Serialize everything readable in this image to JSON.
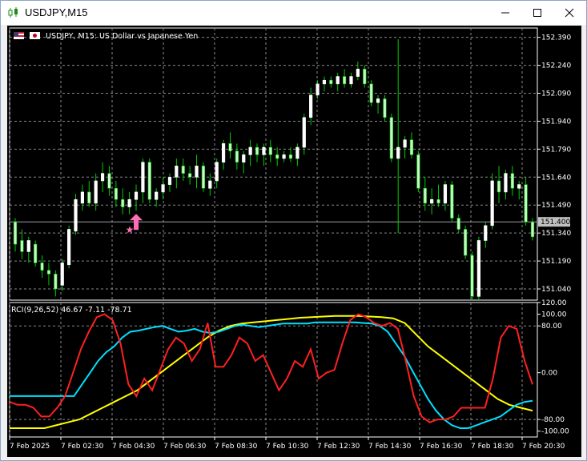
{
  "window": {
    "title": "USDJPY,M15",
    "minimize_icon": "minimize-icon",
    "maximize_icon": "maximize-icon",
    "close_icon": "close-icon"
  },
  "chart": {
    "header_label": "USDJPY, M15:  US Dollar vs Japanese Yen",
    "current_price": "151.400",
    "price_ticks": [
      "152.390",
      "152.240",
      "152.090",
      "151.940",
      "151.790",
      "151.640",
      "151.490",
      "151.340",
      "151.190",
      "151.040"
    ],
    "time_ticks": [
      "7 Feb 2025",
      "7 Feb 02:30",
      "7 Feb 04:30",
      "7 Feb 06:30",
      "7 Feb 08:30",
      "7 Feb 10:30",
      "7 Feb 12:30",
      "7 Feb 14:30",
      "7 Feb 16:30",
      "7 Feb 18:30",
      "7 Feb 20:30"
    ]
  },
  "indicator": {
    "label": "RCI(9,26,52) 46.67 -7.11 -78.71",
    "ticks": [
      "120.00",
      "100.00",
      "80.00",
      "0.00",
      "-80.00",
      "-100.00"
    ]
  },
  "colors": {
    "bull_candle": "#ffffff",
    "bear_candle": "#c8f5c8",
    "wick": "#00cc00",
    "grid": "#8a8a8a",
    "rci_fast": "#ff2020",
    "rci_mid": "#00e0ff",
    "rci_slow": "#ffff00",
    "arrow": "#ff6eb4"
  },
  "chart_data": {
    "type": "candlestick",
    "ylim": [
      150.98,
      152.44
    ],
    "candles": [
      [
        151.4,
        151.42,
        151.24,
        151.28
      ],
      [
        151.3,
        151.36,
        151.2,
        151.24
      ],
      [
        151.24,
        151.32,
        151.18,
        151.3
      ],
      [
        151.28,
        151.3,
        151.16,
        151.18
      ],
      [
        151.18,
        151.22,
        151.1,
        151.14
      ],
      [
        151.14,
        151.18,
        151.06,
        151.12
      ],
      [
        151.12,
        151.14,
        151.0,
        151.04
      ],
      [
        151.06,
        151.2,
        151.03,
        151.18
      ],
      [
        151.17,
        151.38,
        151.15,
        151.36
      ],
      [
        151.35,
        151.55,
        151.33,
        151.52
      ],
      [
        151.5,
        151.6,
        151.46,
        151.56
      ],
      [
        151.56,
        151.62,
        151.48,
        151.5
      ],
      [
        151.5,
        151.66,
        151.46,
        151.62
      ],
      [
        151.62,
        151.72,
        151.56,
        151.66
      ],
      [
        151.66,
        151.7,
        151.54,
        151.58
      ],
      [
        151.58,
        151.62,
        151.48,
        151.52
      ],
      [
        151.52,
        151.58,
        151.44,
        151.48
      ],
      [
        151.48,
        151.56,
        151.44,
        151.52
      ],
      [
        151.52,
        151.6,
        151.46,
        151.56
      ],
      [
        151.56,
        151.74,
        151.5,
        151.72
      ],
      [
        151.72,
        151.74,
        151.5,
        151.52
      ],
      [
        151.52,
        151.58,
        151.48,
        151.56
      ],
      [
        151.56,
        151.64,
        151.52,
        151.6
      ],
      [
        151.6,
        151.66,
        151.56,
        151.64
      ],
      [
        151.64,
        151.74,
        151.58,
        151.7
      ],
      [
        151.7,
        151.74,
        151.62,
        151.66
      ],
      [
        151.66,
        151.7,
        151.6,
        151.64
      ],
      [
        151.64,
        151.76,
        151.58,
        151.7
      ],
      [
        151.7,
        151.72,
        151.56,
        151.58
      ],
      [
        151.58,
        151.66,
        151.54,
        151.62
      ],
      [
        151.62,
        151.74,
        151.58,
        151.72
      ],
      [
        151.72,
        151.84,
        151.68,
        151.82
      ],
      [
        151.82,
        151.88,
        151.74,
        151.78
      ],
      [
        151.78,
        151.82,
        151.68,
        151.72
      ],
      [
        151.72,
        151.78,
        151.66,
        151.76
      ],
      [
        151.76,
        151.84,
        151.7,
        151.8
      ],
      [
        151.8,
        151.82,
        151.72,
        151.76
      ],
      [
        151.76,
        151.82,
        151.7,
        151.8
      ],
      [
        151.8,
        151.84,
        151.72,
        151.76
      ],
      [
        151.76,
        151.8,
        151.7,
        151.74
      ],
      [
        151.74,
        151.78,
        151.72,
        151.76
      ],
      [
        151.76,
        151.8,
        151.72,
        151.74
      ],
      [
        151.74,
        151.82,
        151.7,
        151.8
      ],
      [
        151.8,
        151.98,
        151.76,
        151.96
      ],
      [
        151.96,
        152.12,
        151.92,
        152.08
      ],
      [
        152.08,
        152.16,
        152.06,
        152.14
      ],
      [
        152.14,
        152.18,
        152.1,
        152.16
      ],
      [
        152.16,
        152.18,
        152.12,
        152.14
      ],
      [
        152.14,
        152.2,
        152.1,
        152.18
      ],
      [
        152.18,
        152.22,
        152.12,
        152.14
      ],
      [
        152.14,
        152.2,
        152.12,
        152.18
      ],
      [
        152.18,
        152.26,
        152.16,
        152.22
      ],
      [
        152.22,
        152.24,
        152.12,
        152.14
      ],
      [
        152.14,
        152.16,
        152.02,
        152.04
      ],
      [
        152.04,
        152.08,
        151.98,
        152.06
      ],
      [
        152.06,
        152.08,
        151.94,
        151.96
      ],
      [
        151.96,
        151.98,
        151.72,
        151.74
      ],
      [
        151.74,
        152.38,
        151.34,
        151.8
      ],
      [
        151.8,
        151.86,
        151.74,
        151.84
      ],
      [
        151.84,
        151.88,
        151.74,
        151.76
      ],
      [
        151.76,
        151.78,
        151.56,
        151.58
      ],
      [
        151.58,
        151.64,
        151.46,
        151.5
      ],
      [
        151.5,
        151.58,
        151.44,
        151.52
      ],
      [
        151.52,
        151.6,
        151.48,
        151.5
      ],
      [
        151.5,
        151.62,
        151.46,
        151.6
      ],
      [
        151.6,
        151.62,
        151.4,
        151.42
      ],
      [
        151.42,
        151.44,
        151.34,
        151.36
      ],
      [
        151.36,
        151.38,
        151.2,
        151.22
      ],
      [
        151.22,
        151.24,
        150.98,
        151.0
      ],
      [
        151.0,
        151.32,
        150.98,
        151.3
      ],
      [
        151.3,
        151.4,
        151.26,
        151.38
      ],
      [
        151.38,
        151.66,
        151.36,
        151.62
      ],
      [
        151.62,
        151.7,
        151.5,
        151.56
      ],
      [
        151.56,
        151.68,
        151.52,
        151.66
      ],
      [
        151.66,
        151.7,
        151.54,
        151.58
      ],
      [
        151.58,
        151.62,
        151.52,
        151.6
      ],
      [
        151.6,
        151.64,
        151.38,
        151.4
      ],
      [
        151.4,
        151.42,
        151.3,
        151.32
      ]
    ],
    "signal_marker": {
      "candle_index": 18,
      "price": 151.4
    }
  },
  "rci_data": {
    "ylim": [
      -110,
      120
    ],
    "fast": [
      -50,
      -55,
      -55,
      -60,
      -75,
      -75,
      -60,
      -40,
      0,
      40,
      70,
      95,
      100,
      90,
      50,
      -20,
      -40,
      -10,
      -30,
      5,
      40,
      60,
      50,
      20,
      40,
      85,
      10,
      10,
      30,
      60,
      50,
      20,
      30,
      0,
      -30,
      -10,
      20,
      10,
      40,
      -10,
      0,
      5,
      50,
      90,
      100,
      95,
      85,
      80,
      85,
      75,
      20,
      -40,
      -75,
      -85,
      -80,
      -80,
      -75,
      -60,
      -60,
      -60,
      -60,
      -10,
      60,
      80,
      75,
      20,
      -20
    ],
    "mid": [
      -40,
      -40,
      -40,
      -40,
      -40,
      -40,
      -40,
      -40,
      -40,
      -20,
      0,
      20,
      35,
      45,
      60,
      70,
      72,
      75,
      78,
      80,
      75,
      70,
      72,
      75,
      70,
      68,
      70,
      75,
      80,
      82,
      80,
      78,
      80,
      82,
      84,
      84,
      84,
      84,
      86,
      86,
      86,
      86,
      86,
      86,
      85,
      84,
      80,
      70,
      50,
      30,
      5,
      -20,
      -45,
      -65,
      -80,
      -90,
      -95,
      -95,
      -90,
      -85,
      -80,
      -75,
      -65,
      -55,
      -50,
      -48
    ],
    "slow": [
      -95,
      -95,
      -95,
      -95,
      -90,
      -85,
      -80,
      -70,
      -60,
      -50,
      -40,
      -30,
      -15,
      0,
      15,
      30,
      45,
      60,
      72,
      80,
      84,
      86,
      88,
      90,
      92,
      94,
      95,
      96,
      97,
      97,
      97,
      96,
      95,
      93,
      85,
      65,
      45,
      30,
      15,
      0,
      -15,
      -30,
      -45,
      -55,
      -60,
      -65
    ]
  }
}
